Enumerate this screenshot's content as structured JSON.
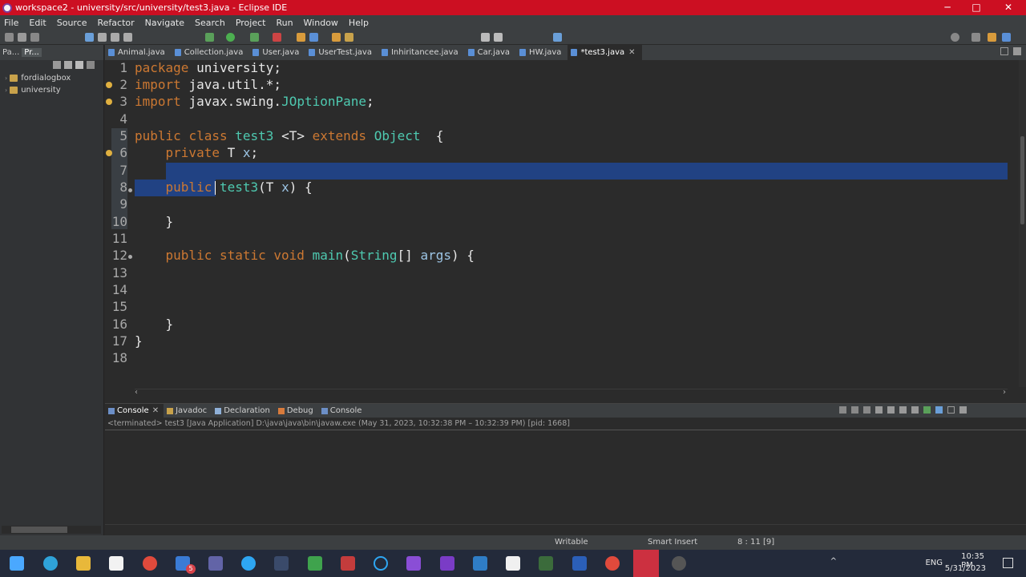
{
  "window": {
    "title": "workspace2 - university/src/university/test3.java - Eclipse IDE",
    "controls": [
      "─",
      "□",
      "✕"
    ]
  },
  "menu": [
    "File",
    "Edit",
    "Source",
    "Refactor",
    "Navigate",
    "Search",
    "Project",
    "Run",
    "Window",
    "Help"
  ],
  "left_pane": {
    "tabs": [
      "Pa...",
      "Pr..."
    ],
    "tree": [
      "fordialogbox",
      "university"
    ]
  },
  "editor_tabs": [
    "Animal.java",
    "Collection.java",
    "User.java",
    "UserTest.java",
    "Inhiritancee.java",
    "Car.java",
    "HW.java",
    "*test3.java"
  ],
  "code_lines": [
    {
      "n": "1",
      "text": "package university;"
    },
    {
      "n": "2",
      "text": "import java.util.*;"
    },
    {
      "n": "3",
      "text": "import javax.swing.JOptionPane;"
    },
    {
      "n": "4",
      "text": ""
    },
    {
      "n": "5",
      "text": "public class test3 <T> extends Object  {"
    },
    {
      "n": "6",
      "text": "    private T x;"
    },
    {
      "n": "7",
      "text": ""
    },
    {
      "n": "8",
      "text": "    public test3(T x) {"
    },
    {
      "n": "9",
      "text": ""
    },
    {
      "n": "10",
      "text": "    }"
    },
    {
      "n": "11",
      "text": ""
    },
    {
      "n": "12",
      "text": "    public static void main(String[] args) {"
    },
    {
      "n": "13",
      "text": ""
    },
    {
      "n": "14",
      "text": ""
    },
    {
      "n": "15",
      "text": ""
    },
    {
      "n": "16",
      "text": "    }"
    },
    {
      "n": "17",
      "text": "}"
    },
    {
      "n": "18",
      "text": ""
    }
  ],
  "bottom_tabs": [
    "Console",
    "Javadoc",
    "Declaration",
    "Debug",
    "Console"
  ],
  "console_status": "<terminated> test3 [Java Application] D:\\java\\java\\bin\\javaw.exe  (May 31, 2023, 10:32:38 PM – 10:32:39 PM) [pid: 1668]",
  "status_bar": {
    "mode": "Writable",
    "insert": "Smart Insert",
    "position": "8 : 11 [9]"
  },
  "taskbar": {
    "time": "10:35 PM",
    "date": "5/31/2023",
    "lang": "ENG",
    "badge": "5"
  },
  "colors": {
    "titlebar": "#cc0f22",
    "keyword": "#cc7832",
    "type": "#4ec9b0",
    "selection": "#214283"
  }
}
